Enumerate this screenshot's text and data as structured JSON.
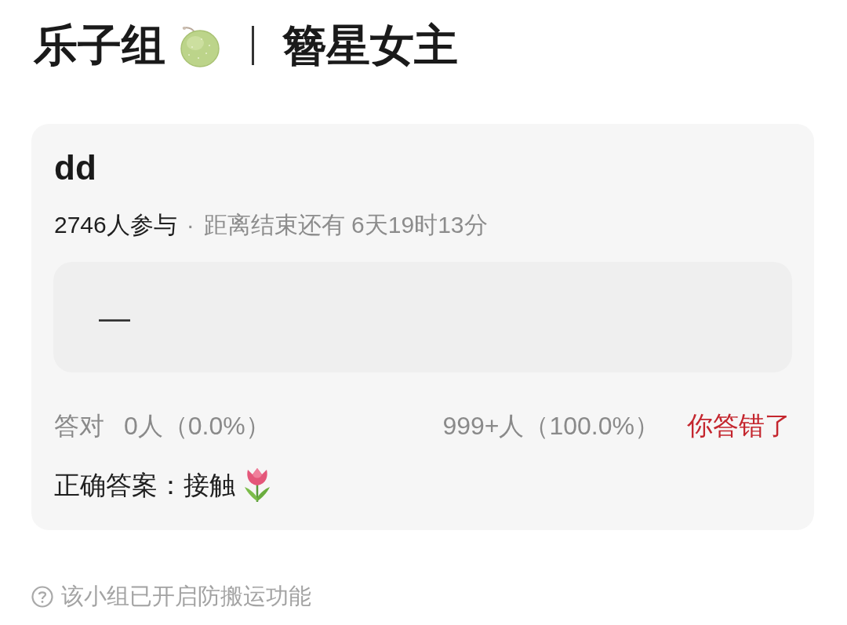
{
  "header": {
    "group_name": "乐子组",
    "topic": "簪星女主"
  },
  "quiz": {
    "title": "dd",
    "participants": "2746人参与",
    "separator": "·",
    "time_left": "距离结束还有 6天19时13分",
    "options": [
      {
        "text": "—"
      }
    ],
    "stats": {
      "correct_label": "答对",
      "correct_count": "0人（0.0%）",
      "other_count": "999+人（100.0%）",
      "result": "你答错了",
      "answered_correctly": false
    },
    "answer": "正确答案：接触"
  },
  "footer": {
    "notice": "该小组已开启防搬运功能"
  }
}
